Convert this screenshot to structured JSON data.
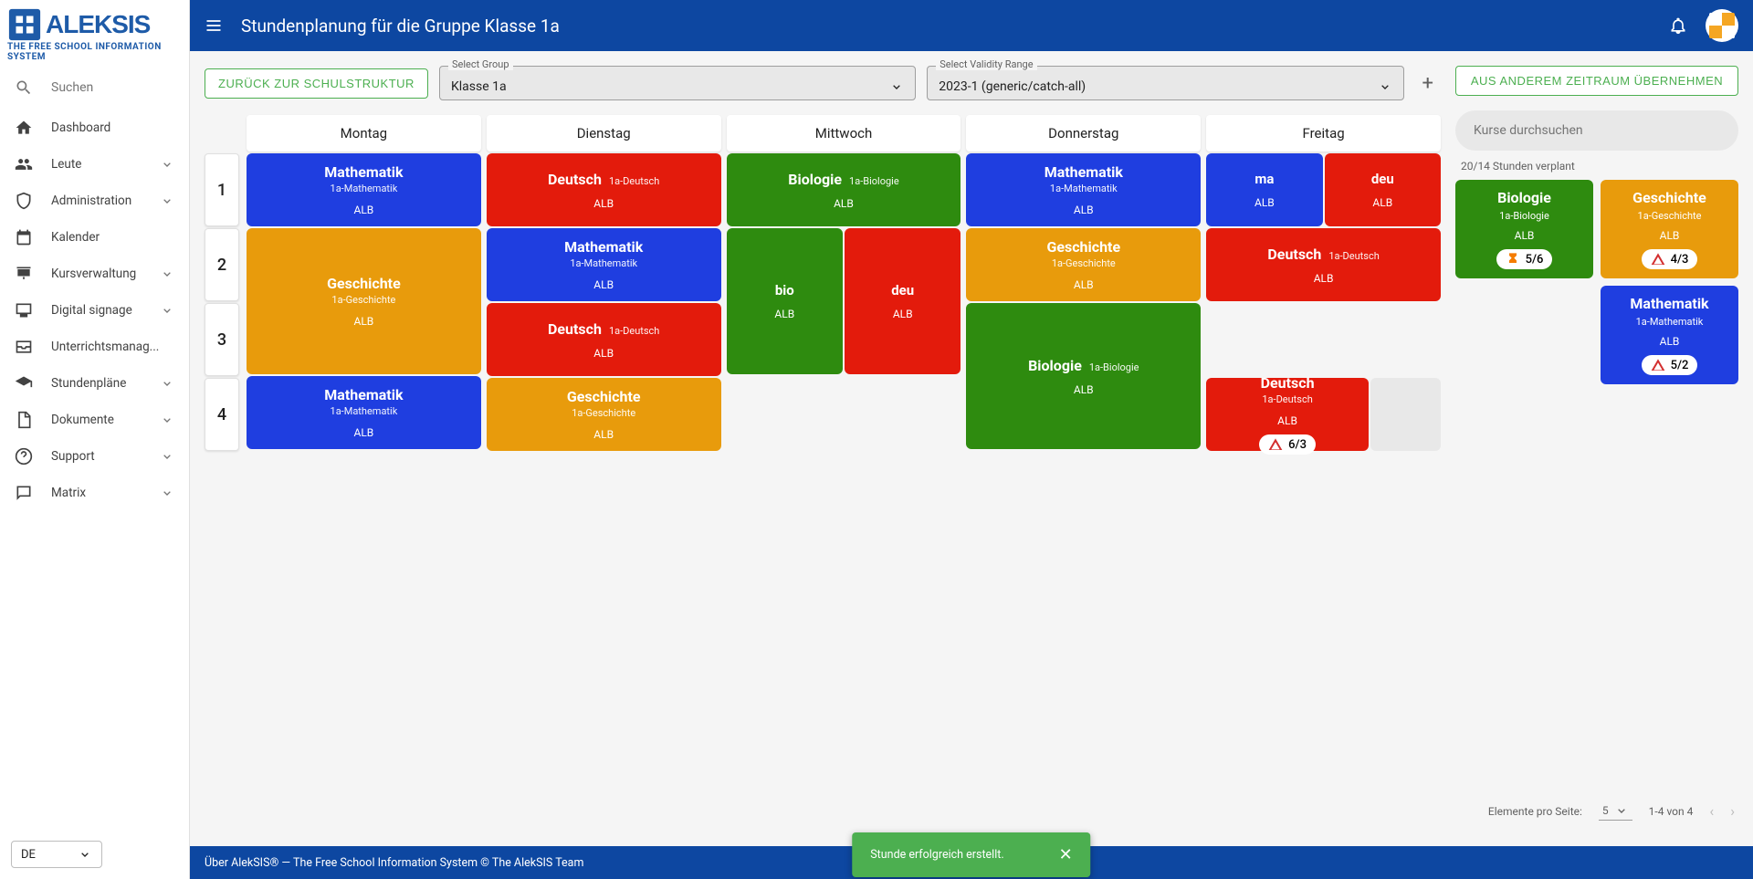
{
  "app": {
    "logo_main": "ALEKSIS",
    "logo_sub": "THE FREE SCHOOL INFORMATION SYSTEM",
    "search_placeholder": "Suchen",
    "lang": "DE"
  },
  "nav": [
    {
      "label": "Dashboard",
      "icon": "home",
      "expandable": false
    },
    {
      "label": "Leute",
      "icon": "people",
      "expandable": true
    },
    {
      "label": "Administration",
      "icon": "shield",
      "expandable": true
    },
    {
      "label": "Kalender",
      "icon": "calendar",
      "expandable": false
    },
    {
      "label": "Kursverwaltung",
      "icon": "presentation",
      "expandable": true
    },
    {
      "label": "Digital signage",
      "icon": "monitor",
      "expandable": true
    },
    {
      "label": "Unterrichtsmanag...",
      "icon": "inbox",
      "expandable": true
    },
    {
      "label": "Stundenpläne",
      "icon": "grad",
      "expandable": true
    },
    {
      "label": "Dokumente",
      "icon": "doc",
      "expandable": true
    },
    {
      "label": "Support",
      "icon": "help",
      "expandable": true
    },
    {
      "label": "Matrix",
      "icon": "chat",
      "expandable": true
    }
  ],
  "header": {
    "title": "Stundenplanung für die Gruppe Klasse 1a"
  },
  "toolbar": {
    "back_label": "ZURÜCK ZUR SCHULSTRUKTUR",
    "group_label": "Select Group",
    "group_value": "Klasse 1a",
    "range_label": "Select Validity Range",
    "range_value": "2023-1 (generic/catch-all)",
    "copy_label": "AUS ANDEREM ZEITRAUM ÜBERNEHMEN"
  },
  "days": [
    "Montag",
    "Dienstag",
    "Mittwoch",
    "Donnerstag",
    "Freitag"
  ],
  "periods": [
    "1",
    "2",
    "3",
    "4"
  ],
  "schedule": {
    "mon": [
      {
        "span": 1,
        "items": [
          {
            "subj": "Mathematik",
            "course": "1a-Mathematik",
            "teacher": "ALB",
            "color": "blue",
            "layout": "stack"
          }
        ]
      },
      {
        "span": 2,
        "items": [
          {
            "subj": "Geschichte",
            "course": "1a-Geschichte",
            "teacher": "ALB",
            "color": "orange",
            "layout": "stack"
          }
        ]
      },
      {
        "span": 1,
        "items": [
          {
            "subj": "Mathematik",
            "course": "1a-Mathematik",
            "teacher": "ALB",
            "color": "blue",
            "layout": "stack"
          }
        ]
      }
    ],
    "tue": [
      {
        "span": 1,
        "items": [
          {
            "subj": "Deutsch",
            "course": "1a-Deutsch",
            "teacher": "ALB",
            "color": "red",
            "layout": "inline"
          }
        ]
      },
      {
        "span": 1,
        "items": [
          {
            "subj": "Mathematik",
            "course": "1a-Mathematik",
            "teacher": "ALB",
            "color": "blue",
            "layout": "stack"
          }
        ]
      },
      {
        "span": 1,
        "items": [
          {
            "subj": "Deutsch",
            "course": "1a-Deutsch",
            "teacher": "ALB",
            "color": "red",
            "layout": "inline"
          }
        ]
      },
      {
        "span": 1,
        "items": [
          {
            "subj": "Geschichte",
            "course": "1a-Geschichte",
            "teacher": "ALB",
            "color": "orange",
            "layout": "stack"
          }
        ]
      }
    ],
    "wed": [
      {
        "span": 1,
        "items": [
          {
            "subj": "Biologie",
            "course": "1a-Biologie",
            "teacher": "ALB",
            "color": "green",
            "layout": "inline"
          }
        ]
      },
      {
        "span": 2,
        "items": [
          {
            "subj": "bio",
            "teacher": "ALB",
            "color": "green",
            "layout": "stack-short"
          },
          {
            "subj": "deu",
            "teacher": "ALB",
            "color": "red",
            "layout": "stack-short"
          }
        ]
      },
      {
        "span": 1,
        "items": []
      }
    ],
    "thu": [
      {
        "span": 1,
        "items": [
          {
            "subj": "Mathematik",
            "course": "1a-Mathematik",
            "teacher": "ALB",
            "color": "blue",
            "layout": "stack"
          }
        ]
      },
      {
        "span": 1,
        "items": [
          {
            "subj": "Geschichte",
            "course": "1a-Geschichte",
            "teacher": "ALB",
            "color": "orange",
            "layout": "stack"
          }
        ]
      },
      {
        "span": 2,
        "items": [
          {
            "subj": "Biologie",
            "course": "1a-Biologie",
            "teacher": "ALB",
            "color": "green",
            "layout": "inline"
          }
        ]
      }
    ],
    "fri": [
      {
        "span": 1,
        "items": [
          {
            "subj": "ma",
            "teacher": "ALB",
            "color": "blue",
            "layout": "stack-short"
          },
          {
            "subj": "deu",
            "teacher": "ALB",
            "color": "red",
            "layout": "stack-short"
          }
        ]
      },
      {
        "span": 1,
        "items": [
          {
            "subj": "Deutsch",
            "course": "1a-Deutsch",
            "teacher": "ALB",
            "color": "red",
            "layout": "inline"
          }
        ]
      },
      {
        "span": 1,
        "items": []
      },
      {
        "span": 1,
        "items": [
          {
            "subj": "Deutsch",
            "course": "1a-Deutsch",
            "teacher": "ALB",
            "color": "red",
            "layout": "stack",
            "badge": {
              "type": "warn",
              "text": "6/3"
            }
          }
        ],
        "withEmpty": true
      }
    ]
  },
  "courses": {
    "search_placeholder": "Kurse durchsuchen",
    "hours_info": "20/14 Stunden verplant",
    "list": [
      {
        "subj": "Biologie",
        "course": "1a-Biologie",
        "teacher": "ALB",
        "color": "green",
        "badge": {
          "type": "hourglass",
          "text": "5/6"
        }
      },
      {
        "subj": "Geschichte",
        "course": "1a-Geschichte",
        "teacher": "ALB",
        "color": "orange",
        "badge": {
          "type": "warn",
          "text": "4/3"
        }
      },
      {
        "subj": "",
        "course": "",
        "teacher": "",
        "color": "",
        "empty": true
      },
      {
        "subj": "Mathematik",
        "course": "1a-Mathematik",
        "teacher": "ALB",
        "color": "blue",
        "badge": {
          "type": "warn",
          "text": "5/2"
        }
      }
    ],
    "page_label": "Elemente pro Seite:",
    "page_size": "5",
    "page_range": "1-4 von 4"
  },
  "footer": {
    "text": "Über AlekSIS® — The Free School Information System © The AlekSIS Team"
  },
  "snackbar": {
    "text": "Stunde erfolgreich erstellt."
  }
}
